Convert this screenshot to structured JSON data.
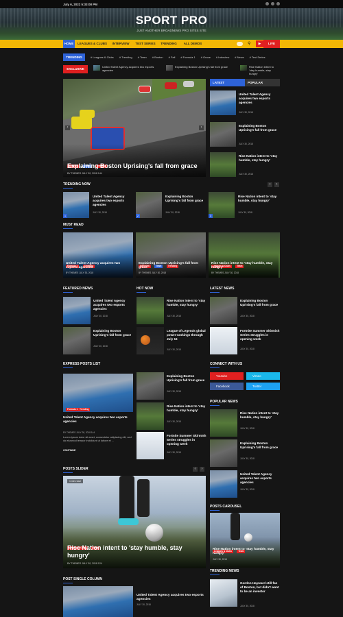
{
  "topbar": {
    "date": "July 6, 2022 5:33:08 PM"
  },
  "site": {
    "title": "SPORT PRO",
    "tagline": "JUST ANOTHER BROADNEWS PRO SITES SITE"
  },
  "nav": {
    "items": [
      "HOME",
      "LEAGUES & CLUBS",
      "INTERVIEW",
      "TEST SERIES",
      "TRENDING",
      "ALL DEMOS"
    ],
    "live": "LIVE"
  },
  "trending": {
    "label": "TRENDING",
    "tags": [
      "# Leagues & Clubs",
      "# Trending",
      "# Team",
      "# Boston",
      "# Fall",
      "# Formula 1",
      "# Grace",
      "# Interview",
      "# News",
      "# Test Series"
    ]
  },
  "exclusive": {
    "label": "EXCLUSIVE",
    "items": [
      "United Talent Agency acquires two esports agencies",
      "Explaining Boston Uprising's fall from grace",
      "Rise Nation intent to 'stay humble, stay hungry'"
    ]
  },
  "main_slider": {
    "badges": [
      "Interview",
      "Team",
      "Trending"
    ],
    "title": "Explaining Boston Uprising's fall from grace",
    "meta": "BY THEMES   JULY 30, 2018   144"
  },
  "sidebar_tabs": {
    "latest": "LATEST",
    "popular": "POPULAR"
  },
  "latest": [
    {
      "title": "United Talent Agency acquires two esports agencies",
      "meta": "JULY 30, 2018"
    },
    {
      "title": "Explaining Boston Uprising's fall from grace",
      "meta": "JULY 30, 2018"
    },
    {
      "title": "Rise Nation intent to 'stay humble, stay hungry'",
      "meta": "JULY 30, 2018"
    }
  ],
  "trending_now": {
    "heading": "TRENDING NOW",
    "items": [
      {
        "num": "1",
        "title": "United Talent Agency acquires two esports agencies",
        "meta": "JULY 30, 2018"
      },
      {
        "num": "2",
        "title": "Explaining Boston Uprising's fall from grace",
        "meta": "JULY 30, 2018"
      },
      {
        "num": "3",
        "title": "Rise Nation intent to 'stay humble, stay hungry'",
        "meta": "JULY 30, 2018"
      }
    ]
  },
  "must_read": {
    "heading": "MUST READ",
    "items": [
      {
        "badges": [
          "Formula 1",
          "Trending"
        ],
        "title": "United Talent Agency acquires two esports agencies",
        "meta": "BY THEMES   JULY 30, 2018"
      },
      {
        "badges": [
          "Interview",
          "Team",
          "Trending"
        ],
        "title": "Explaining Boston Uprising's fall from grace",
        "meta": "BY THEMES   JULY 30, 2018"
      },
      {
        "badges": [
          "Leagues & Clubs",
          "Team"
        ],
        "title": "Rise Nation intent to 'stay humble, stay hungry'",
        "meta": "BY THEMES   JULY 30, 2018"
      }
    ]
  },
  "featured_news": {
    "heading": "FEATURED NEWS",
    "items": [
      {
        "title": "United Talent Agency acquires two esports agencies",
        "meta": "JULY 30, 2018"
      },
      {
        "title": "Explaining Boston Uprising's fall from grace",
        "meta": "JULY 30, 2018"
      }
    ]
  },
  "hot_now": {
    "heading": "HOT NOW",
    "items": [
      {
        "title": "Rise Nation intent to 'stay humble, stay hungry'",
        "meta": "JULY 30, 2018"
      },
      {
        "title": "League of Legends global power-rankings through July 16",
        "meta": "JULY 30, 2018"
      }
    ]
  },
  "latest_news": {
    "heading": "LATEST NEWS",
    "items": [
      {
        "title": "Explaining Boston Uprising's fall from grace",
        "meta": "JULY 30, 2018"
      },
      {
        "title": "Fortnite Summer Skirmish Series struggles in opening week",
        "meta": "JULY 30, 2018"
      }
    ]
  },
  "express": {
    "heading": "EXPRESS POSTS LIST",
    "big": {
      "badges": [
        "Formula 1",
        "Trending"
      ],
      "title": "United Talent Agency acquires two esports agencies",
      "meta": "BY THEMES   JULY 30, 2018   144",
      "excerpt": "Lorem ipsum dolor sit amet, consectetur adipiscing elit, sed do eiusmod tempor incididunt ut labore et ...",
      "continue": "CONTINUE"
    },
    "items": [
      {
        "title": "Explaining Boston Uprising's fall from grace",
        "meta": "JULY 30, 2018"
      },
      {
        "title": "Rise Nation intent to 'stay humble, stay hungry'",
        "meta": "JULY 30, 2018"
      },
      {
        "title": "Fortnite Summer Skirmish Series struggles in opening week",
        "meta": "JULY 30, 2018"
      }
    ]
  },
  "connect": {
    "heading": "CONNECT WITH US",
    "buttons": [
      "Youtube",
      "Vimeo",
      "Facebook",
      "Twitter"
    ],
    "colors": [
      "#e02020",
      "#1ab7ea",
      "#3b5998",
      "#1da1f2"
    ]
  },
  "popular_news": {
    "heading": "POPULAR NEWS",
    "items": [
      {
        "title": "Rise Nation intent to 'stay humble, stay hungry'",
        "meta": "JULY 30, 2018"
      },
      {
        "title": "Explaining Boston Uprising's fall from grace",
        "meta": "JULY 30, 2018"
      },
      {
        "title": "United Talent Agency acquires two esports agencies",
        "meta": "JULY 30, 2018"
      }
    ]
  },
  "posts_slider": {
    "heading": "POSTS SLIDER",
    "badges": [
      "Leagues & Clubs",
      "Team"
    ],
    "title": "Rise Nation intent to 'stay humble, stay hungry'",
    "meta": "BY THEMES   JULY 30, 2018   124",
    "time": "1 min read"
  },
  "posts_carousel": {
    "heading": "POSTS CAROUSEL",
    "badges": [
      "Leagues & Clubs",
      "Team"
    ],
    "title": "Rise Nation intent to 'stay humble, stay hungry'",
    "meta": "JULY 30, 2018"
  },
  "post_single": {
    "heading": "POST SINGLE COLUMN",
    "title": "United Talent Agency acquires two esports agencies",
    "meta": "JULY 30, 2018"
  },
  "trending_news": {
    "heading": "TRENDING NEWS",
    "items": [
      {
        "title": "Gordon Hayward still fan of Boston, but didn't want to be an investor",
        "meta": "JULY 30, 2018"
      }
    ]
  },
  "accent": "#2e63d8"
}
